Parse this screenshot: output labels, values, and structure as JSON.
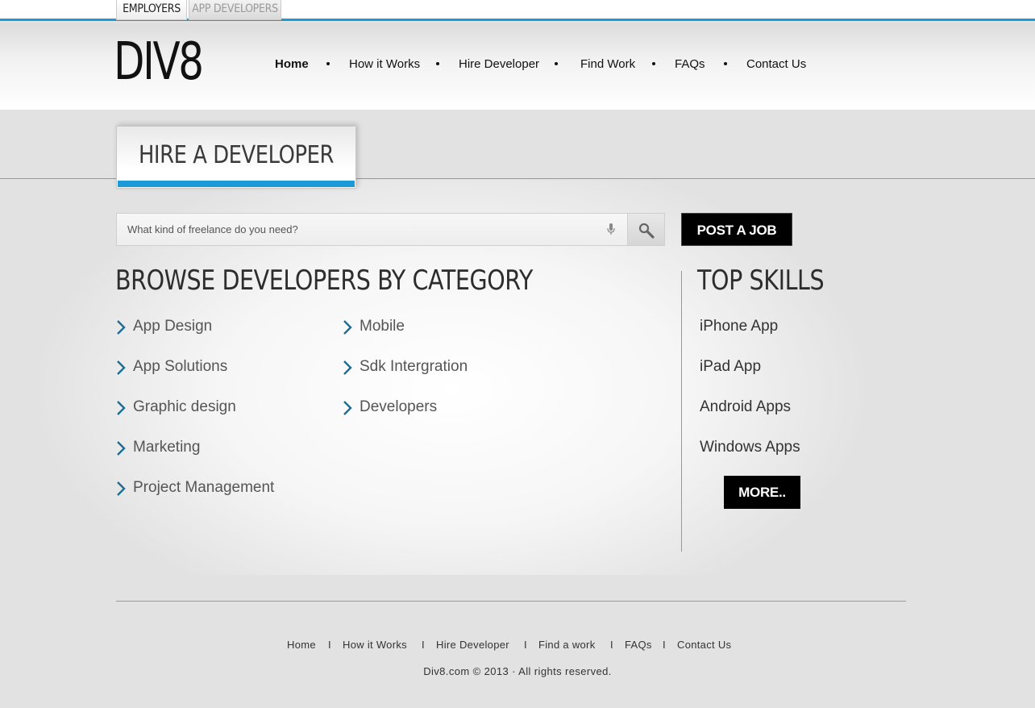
{
  "top_tabs": {
    "employers": "EMPLOYERS",
    "app_developers": "APP DEVELOPERS"
  },
  "logo": "DIV8",
  "nav": {
    "home": "Home",
    "how_it_works": "How it Works",
    "hire_developer": "Hire Developer",
    "find_work": "Find Work",
    "faqs": "FAQs",
    "contact_us": "Contact Us"
  },
  "page_title": "HIRE A DEVELOPER",
  "search": {
    "placeholder": "What kind of freelance do you need?"
  },
  "post_job_label": "POST A JOB",
  "browse": {
    "heading": "BROWSE DEVELOPERS BY CATEGORY",
    "col1": [
      "App Design",
      "App Solutions",
      "Graphic design",
      "Marketing",
      "Project Management"
    ],
    "col2": [
      "Mobile",
      "Sdk Intergration",
      "Developers"
    ]
  },
  "top_skills": {
    "heading": "TOP SKILLS",
    "items": [
      "iPhone App",
      "iPad App",
      "Android Apps",
      "Windows Apps"
    ],
    "more_label": "MORE.."
  },
  "footer": {
    "nav": {
      "home": "Home",
      "how_it_works": "How it Works",
      "hire_developer": "Hire Developer",
      "find_a_work": "Find a work",
      "faqs": "FAQs",
      "contact_us": "Contact Us"
    },
    "separator": "I",
    "copyright": "Div8.com © 2013 · All rights reserved."
  },
  "colors": {
    "accent": "#1a9ad6",
    "button_bg": "#000000",
    "page_bg": "#e2e2e2"
  },
  "icons": {
    "search": "magnifier-icon",
    "mic": "microphone-icon",
    "chevron": "chevron-right-icon"
  }
}
